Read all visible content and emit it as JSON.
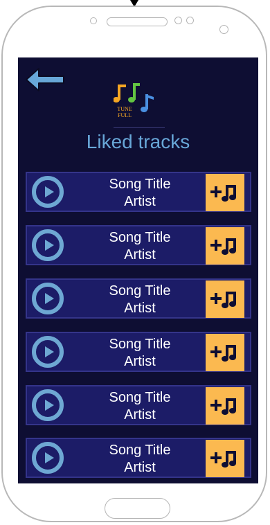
{
  "header": {
    "logo_line1": "TUNE",
    "logo_line2": "FULL",
    "title": "Liked tracks"
  },
  "tracks": [
    {
      "title": "Song Title",
      "artist": "Artist"
    },
    {
      "title": "Song Title",
      "artist": "Artist"
    },
    {
      "title": "Song Title",
      "artist": "Artist"
    },
    {
      "title": "Song Title",
      "artist": "Artist"
    },
    {
      "title": "Song Title",
      "artist": "Artist"
    },
    {
      "title": "Song Title",
      "artist": "Artist"
    }
  ],
  "icons": {
    "back": "arrow-left-icon",
    "play": "play-icon",
    "add": "add-to-playlist-icon"
  },
  "colors": {
    "screen_bg": "#0e0e33",
    "row_bg": "#1c1c67",
    "accent_blue": "#68a7d8",
    "add_button": "#fbb950"
  }
}
